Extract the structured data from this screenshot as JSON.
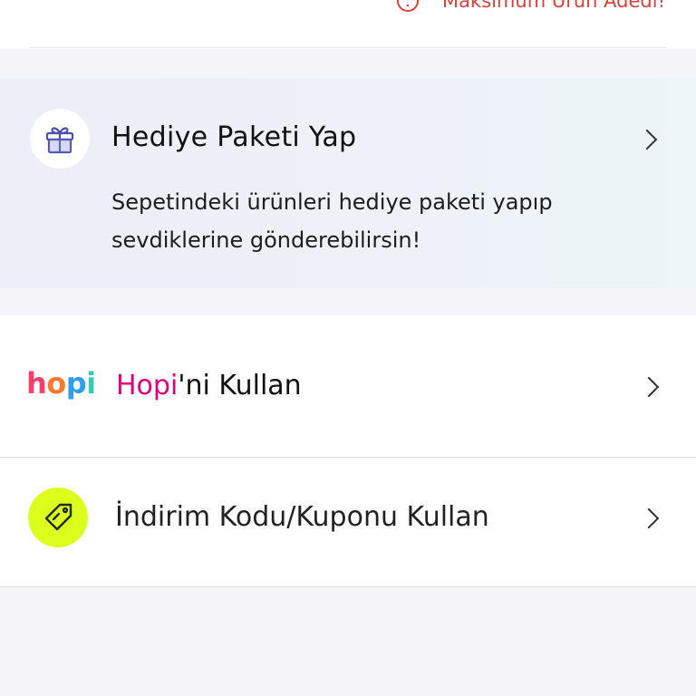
{
  "top": {
    "warning_text": "Maksimum Ürün Adedi!",
    "warning_icon": "warning-circle-icon",
    "warning_color": "#e0403a"
  },
  "gift": {
    "icon": "gift-icon",
    "title": "Hediye Paketi Yap",
    "description": "Sepetindeki ürünleri hediye paketi yapıp sevdiklerine gönderebilirsin!",
    "chevron_icon": "chevron-right-icon"
  },
  "hopi": {
    "logo_letters": [
      "h",
      "o",
      "p",
      "i"
    ],
    "title_brand": "Hopi",
    "title_rest": "'ni Kullan",
    "brand_color": "#e4007d",
    "chevron_icon": "chevron-right-icon"
  },
  "coupon": {
    "icon": "tag-icon",
    "title": "İndirim Kodu/Kuponu Kullan",
    "icon_bg": "#dcff1e",
    "chevron_icon": "chevron-right-icon"
  }
}
